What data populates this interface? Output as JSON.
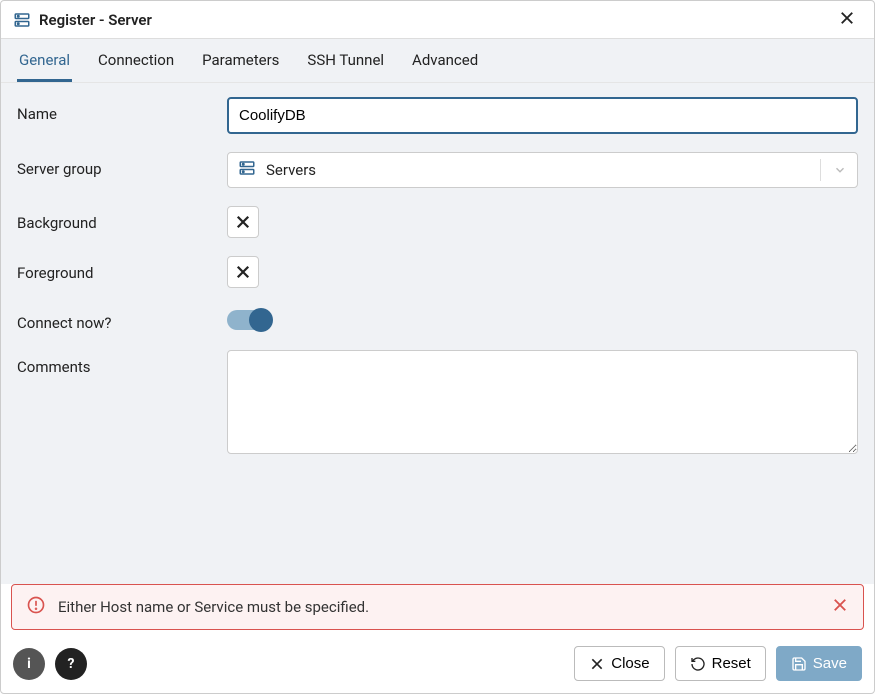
{
  "dialog": {
    "title": "Register - Server"
  },
  "tabs": {
    "general": "General",
    "connection": "Connection",
    "parameters": "Parameters",
    "ssh_tunnel": "SSH Tunnel",
    "advanced": "Advanced",
    "active": "general"
  },
  "form": {
    "name": {
      "label": "Name",
      "value": "CoolifyDB"
    },
    "server_group": {
      "label": "Server group",
      "value": "Servers"
    },
    "background": {
      "label": "Background"
    },
    "foreground": {
      "label": "Foreground"
    },
    "connect_now": {
      "label": "Connect now?",
      "value": true
    },
    "comments": {
      "label": "Comments",
      "value": ""
    }
  },
  "error": {
    "message": "Either Host name or Service must be specified."
  },
  "footer": {
    "close": "Close",
    "reset": "Reset",
    "save": "Save"
  }
}
